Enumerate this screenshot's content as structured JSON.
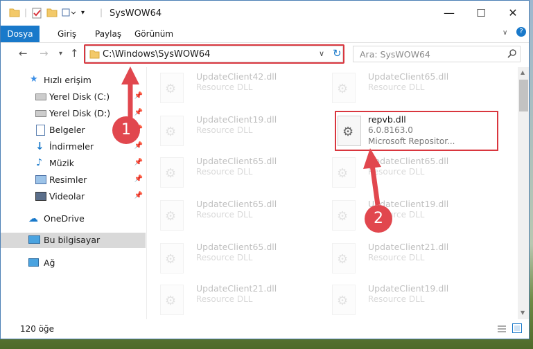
{
  "window": {
    "title": "SysWOW64"
  },
  "controls": {
    "minimize": "—",
    "maximize": "☐",
    "close": "✕"
  },
  "ribbon": {
    "tabs": [
      "Dosya",
      "Giriş",
      "Paylaş",
      "Görünüm"
    ]
  },
  "address": {
    "path": "C:\\Windows\\SysWOW64"
  },
  "search": {
    "placeholder": "Ara: SysWOW64"
  },
  "sidebar": {
    "items": [
      {
        "label": "Hızlı erişim",
        "icon": "star-icon",
        "pinned": false
      },
      {
        "label": "Yerel Disk (C:)",
        "icon": "drive-icon",
        "pinned": true
      },
      {
        "label": "Yerel Disk (D:)",
        "icon": "drive-icon",
        "pinned": true
      },
      {
        "label": "Belgeler",
        "icon": "documents-icon",
        "pinned": true
      },
      {
        "label": "İndirmeler",
        "icon": "download-icon",
        "pinned": true
      },
      {
        "label": "Müzik",
        "icon": "music-icon",
        "pinned": true
      },
      {
        "label": "Resimler",
        "icon": "pictures-icon",
        "pinned": true
      },
      {
        "label": "Videolar",
        "icon": "video-icon",
        "pinned": true
      },
      {
        "label": "OneDrive",
        "icon": "cloud-icon",
        "pinned": false
      },
      {
        "label": "Bu bilgisayar",
        "icon": "computer-icon",
        "pinned": false,
        "selected": true
      },
      {
        "label": "Ağ",
        "icon": "network-icon",
        "pinned": false
      }
    ]
  },
  "files": {
    "left": [
      {
        "name": "UpdateClient42.dll",
        "type": "Resource DLL"
      },
      {
        "name": "UpdateClient19.dll",
        "type": "Resource DLL"
      },
      {
        "name": "UpdateClient65.dll",
        "type": "Resource DLL"
      },
      {
        "name": "UpdateClient65.dll",
        "type": "Resource DLL"
      },
      {
        "name": "UpdateClient65.dll",
        "type": "Resource DLL"
      },
      {
        "name": "UpdateClient21.dll",
        "type": "Resource DLL"
      }
    ],
    "right": [
      {
        "name": "UpdateClient65.dll",
        "type": "Resource DLL"
      },
      {
        "name": "UpdateClient65.dll",
        "type": "Resource DLL"
      },
      {
        "name": "UpdateClient19.dll",
        "type": "Resource DLL"
      },
      {
        "name": "UpdateClient21.dll",
        "type": "Resource DLL"
      },
      {
        "name": "UpdateClient19.dll",
        "type": "Resource DLL"
      }
    ],
    "highlighted": {
      "name": "repvb.dll",
      "version": "6.0.8163.0",
      "company": "Microsoft Repositor..."
    }
  },
  "annotations": {
    "step1": "1",
    "step2": "2"
  },
  "status": {
    "count": "120 öğe"
  },
  "colors": {
    "accent": "#1979ca",
    "highlight": "#d9363e"
  }
}
